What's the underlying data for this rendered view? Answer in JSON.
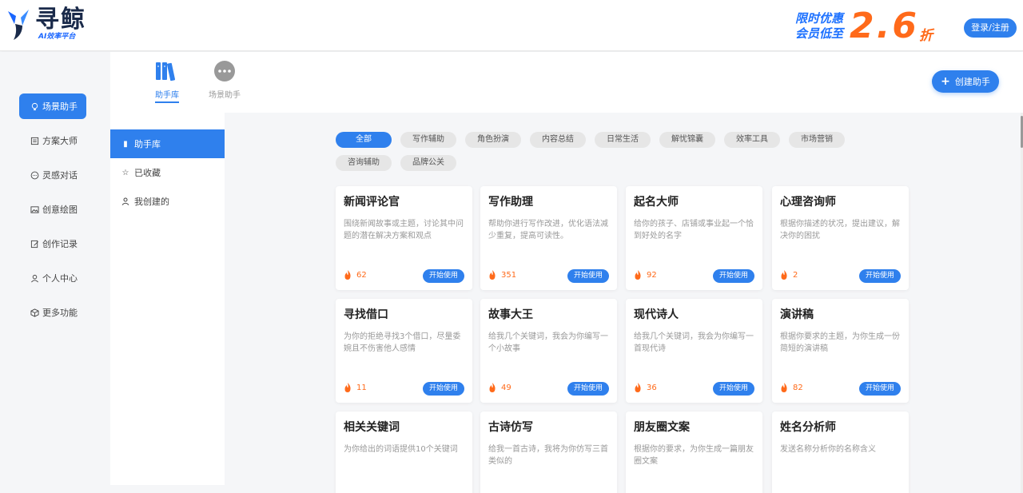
{
  "header": {
    "logo_title": "寻鲸",
    "logo_sub": "AI效率平台",
    "promo_line1": "限时优惠",
    "promo_line2": "会员低至",
    "promo_value": "2.6",
    "promo_unit": "折",
    "login_label": "登录/注册"
  },
  "sidebar": {
    "items": [
      {
        "label": "场景助手",
        "icon": "lightbulb-icon"
      },
      {
        "label": "方案大师",
        "icon": "document-icon"
      },
      {
        "label": "灵感对话",
        "icon": "chat-icon"
      },
      {
        "label": "创意绘图",
        "icon": "image-icon"
      },
      {
        "label": "创作记录",
        "icon": "edit-icon"
      },
      {
        "label": "个人中心",
        "icon": "user-icon"
      },
      {
        "label": "更多功能",
        "icon": "cube-icon"
      }
    ]
  },
  "top_tabs": [
    {
      "label": "助手库",
      "icon": "books-icon"
    },
    {
      "label": "场景助手",
      "icon": "chat-bubble-icon"
    }
  ],
  "create_label": "创建助手",
  "subnav": [
    {
      "label": "助手库",
      "icon": "book-icon"
    },
    {
      "label": "已收藏",
      "icon": "star-icon"
    },
    {
      "label": "我创建的",
      "icon": "person-icon"
    }
  ],
  "categories": [
    "全部",
    "写作辅助",
    "角色扮演",
    "内容总结",
    "日常生活",
    "解忧锦囊",
    "效率工具",
    "市场营销",
    "咨询辅助",
    "品牌公关"
  ],
  "card_button_label": "开始使用",
  "cards": [
    {
      "title": "新闻评论官",
      "desc": "围绕新闻故事或主题，讨论其中问题的潜在解决方案和观点",
      "hot": "62"
    },
    {
      "title": "写作助理",
      "desc": "帮助你进行写作改进，优化语法减少重复，提高可读性。",
      "hot": "351"
    },
    {
      "title": "起名大师",
      "desc": "给你的孩子、店铺或事业起一个恰到好处的名字",
      "hot": "92"
    },
    {
      "title": "心理咨询师",
      "desc": "根据你描述的状况，提出建议，解决你的困扰",
      "hot": "2"
    },
    {
      "title": "寻找借口",
      "desc": "为你的拒绝寻找3个借口，尽量委婉且不伤害他人感情",
      "hot": "11"
    },
    {
      "title": "故事大王",
      "desc": "给我几个关键词，我会为你编写一个小故事",
      "hot": "49"
    },
    {
      "title": "现代诗人",
      "desc": "给我几个关键词，我会为你编写一首现代诗",
      "hot": "36"
    },
    {
      "title": "演讲稿",
      "desc": "根据你要求的主题，为你生成一份简短的演讲稿",
      "hot": "82"
    },
    {
      "title": "相关关键词",
      "desc": "为你给出的词语提供10个关键词",
      "hot": ""
    },
    {
      "title": "古诗仿写",
      "desc": "给我一首古诗，我将为你仿写三首类似的",
      "hot": ""
    },
    {
      "title": "朋友圈文案",
      "desc": "根据你的要求，为你生成一篇朋友圈文案",
      "hot": ""
    },
    {
      "title": "姓名分析师",
      "desc": "发送名称分析你的名称含义",
      "hot": ""
    }
  ],
  "colors": {
    "accent": "#2f80ed",
    "hot": "#ff6a1a"
  }
}
